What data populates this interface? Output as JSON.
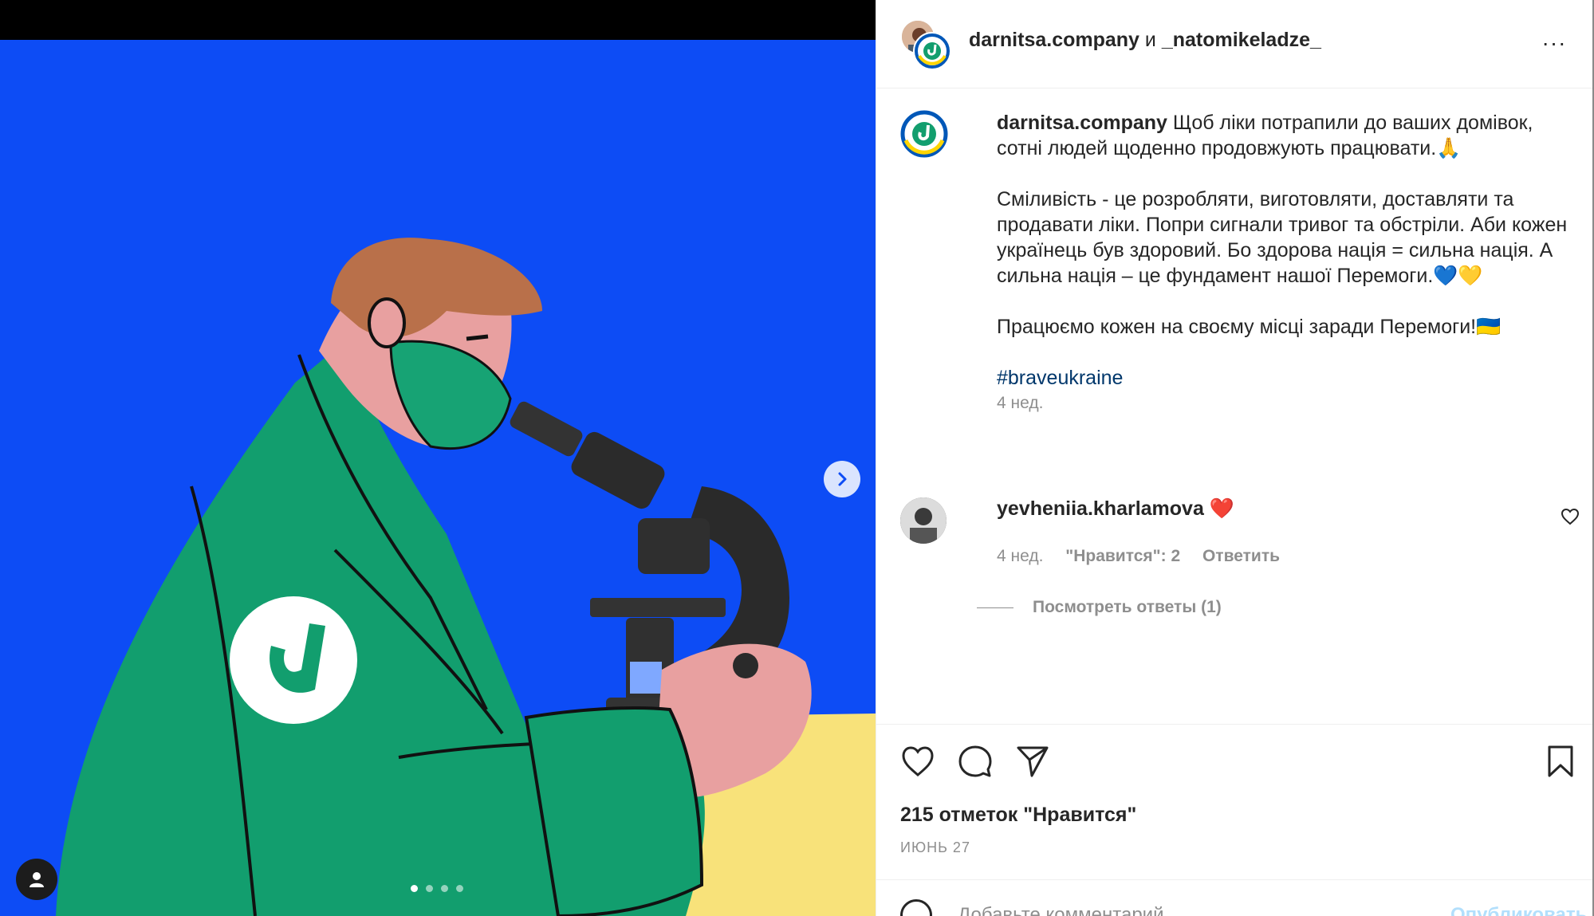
{
  "colors": {
    "background_blue": "#0d4cf5",
    "coat_green": "#129e6e",
    "table_yellow": "#f8e27a",
    "hair_brown": "#b9704a",
    "hashtag_blue": "#00376b",
    "muted_gray": "#8e8e8e",
    "publish_disabled": "#b2dffc"
  },
  "media": {
    "next_icon": "chevron-right-icon",
    "tag_icon": "user-tag-icon",
    "slide_count": 4,
    "active_slide": 1
  },
  "header": {
    "author": "darnitsa.company",
    "separator": "и",
    "collaborator": "_natomikeladze_",
    "more_label": "···"
  },
  "caption": {
    "user": "darnitsa.company",
    "line1": "Щоб ліки потрапили до ваших домівок, сотні людей щоденно продовжують працювати.🙏",
    "paragraph2": "Сміливість - це розробляти, виготовляти, доставляти та продавати ліки. Попри сигнали тривог та обстріли. Аби кожен українець був здоровий. Бо здорова нація = сильна нація. А сильна нація – це фундамент нашої Перемоги.💙💛",
    "paragraph3": "Працюємо кожен на своєму місці заради Перемоги!🇺🇦",
    "hashtag": "#braveukraine",
    "time": "4 нед."
  },
  "comment": {
    "user": "yevheniia.kharlamova",
    "text": "❤️",
    "time": "4 нед.",
    "likes": "\"Нравится\": 2",
    "reply": "Ответить",
    "view_replies": "Посмотреть ответы (1)"
  },
  "actions": {
    "like_icon": "heart-icon",
    "comment_icon": "comment-icon",
    "share_icon": "send-icon",
    "save_icon": "bookmark-icon"
  },
  "likes_count": "215 отметок \"Нравится\"",
  "post_date": "ИЮНЬ 27",
  "add_comment": {
    "placeholder": "Добавьте комментарий...",
    "publish_label": "Опубликовать"
  }
}
